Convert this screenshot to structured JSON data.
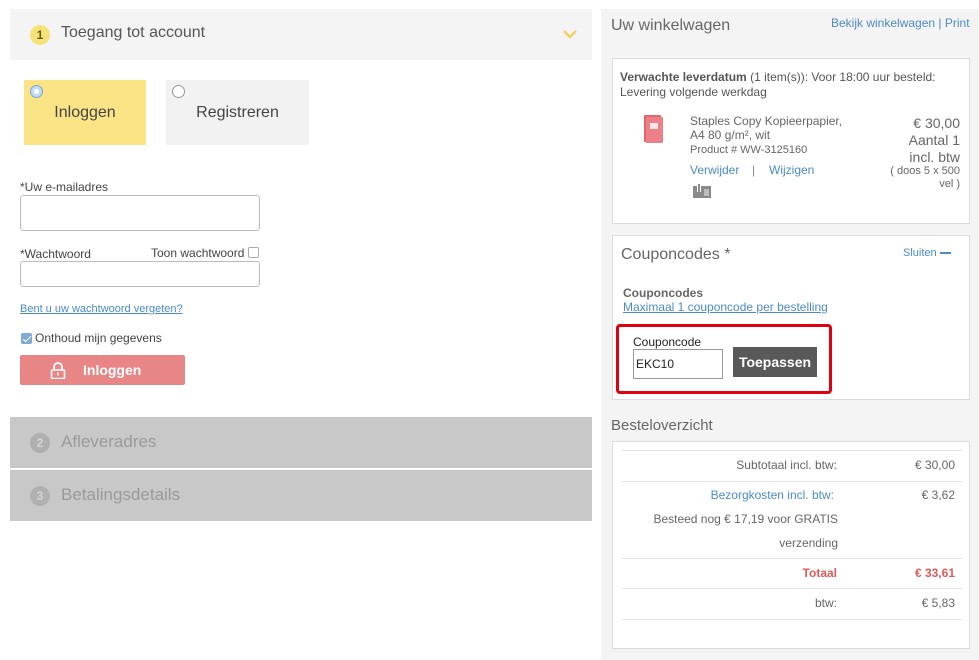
{
  "checkout": {
    "step1": {
      "number": "1",
      "title": "Toegang tot account"
    },
    "tabs": {
      "login": "Inloggen",
      "register": "Registreren"
    },
    "form": {
      "email_label": "*Uw e-mailadres",
      "email_value": "",
      "password_label": "*Wachtwoord",
      "password_value": "",
      "show_password": "Toon wachtwoord",
      "forgot": "Bent u uw wachtwoord vergeten?",
      "remember": "Onthoud mijn gegevens",
      "login_button": "Inloggen"
    },
    "step2": {
      "number": "2",
      "title": "Afleveradres"
    },
    "step3": {
      "number": "3",
      "title": "Betalingsdetails"
    }
  },
  "cart": {
    "title": "Uw winkelwagen",
    "view_link": "Bekijk winkelwagen",
    "separator": "|",
    "print_link": "Print",
    "delivery_label": "Verwachte leverdatum",
    "delivery_text": " (1 item(s)): Voor 18:00 uur besteld: Levering volgende werkdag",
    "product": {
      "name": "Staples Copy Kopieerpapier, A4 80 g/m², wit",
      "number": "Product # WW-3125160",
      "price": "€ 30,00",
      "quantity": "Aantal 1",
      "tax": "incl. btw",
      "pack": "( doos 5 x 500 vel )",
      "remove": "Verwijder",
      "link_sep": "|",
      "change": "Wijzigen"
    }
  },
  "coupon": {
    "title": "Couponcodes *",
    "close": "Sluiten",
    "subtitle": "Couponcodes",
    "limit": "Maximaal 1 couponcode per bestelling",
    "label": "Couponcode",
    "value": "EKC10",
    "apply": "Toepassen"
  },
  "summary": {
    "title": "Besteloverzicht",
    "subtotal_label": "Subtotaal incl. btw:",
    "subtotal_value": "€ 30,00",
    "shipping_label": "Bezorgkosten incl. btw:",
    "shipping_value": "€ 3,62",
    "free_line1": "Besteed nog € 17,19 voor  GRATIS",
    "free_line2": "verzending",
    "total_label": "Totaal",
    "total_value": "€ 33,61",
    "vat_label": "btw:",
    "vat_value": "€ 5,83"
  },
  "colors": {
    "accent_yellow": "#fae486",
    "login_red": "#e88686",
    "link_blue": "#4a8bc9",
    "highlight_red": "#e0000f"
  },
  "icons": [
    "chevron-down-icon",
    "lock-icon",
    "product-thumbnail",
    "box-pack-icon",
    "minus-icon"
  ]
}
